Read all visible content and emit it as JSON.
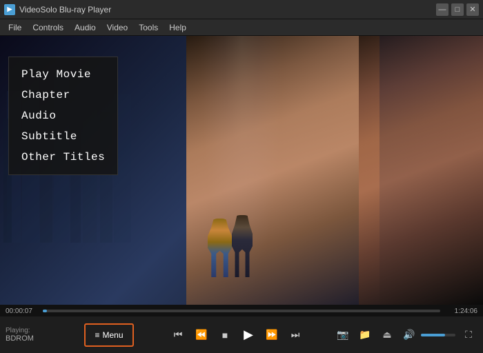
{
  "titlebar": {
    "icon_text": "▶",
    "title": "VideoSolo Blu-ray Player",
    "minimize_label": "—",
    "maximize_label": "□",
    "close_label": "✕"
  },
  "menubar": {
    "items": [
      {
        "label": "File"
      },
      {
        "label": "Controls"
      },
      {
        "label": "Audio"
      },
      {
        "label": "Video"
      },
      {
        "label": "Tools"
      },
      {
        "label": "Help"
      }
    ]
  },
  "context_menu": {
    "items": [
      {
        "label": "Play Movie"
      },
      {
        "label": "Chapter"
      },
      {
        "label": "Audio"
      },
      {
        "label": "Subtitle"
      },
      {
        "label": "Other Titles"
      }
    ]
  },
  "progress": {
    "time_start": "00:00:07",
    "time_end": "1:24:06",
    "fill_percent": 1
  },
  "controls": {
    "playing_label": "Playing:",
    "playing_source": "BDROM",
    "menu_icon": "≡",
    "menu_label": "Menu",
    "prev_chapter": "⏮",
    "rewind": "⏪",
    "stop": "■",
    "play": "▶",
    "fast_forward": "⏩",
    "next_chapter": "⏭",
    "snapshot_icon": "📷",
    "folder_icon": "📁",
    "eject_icon": "⏏",
    "volume_icon": "🔊",
    "fullscreen_icon": "⛶"
  }
}
